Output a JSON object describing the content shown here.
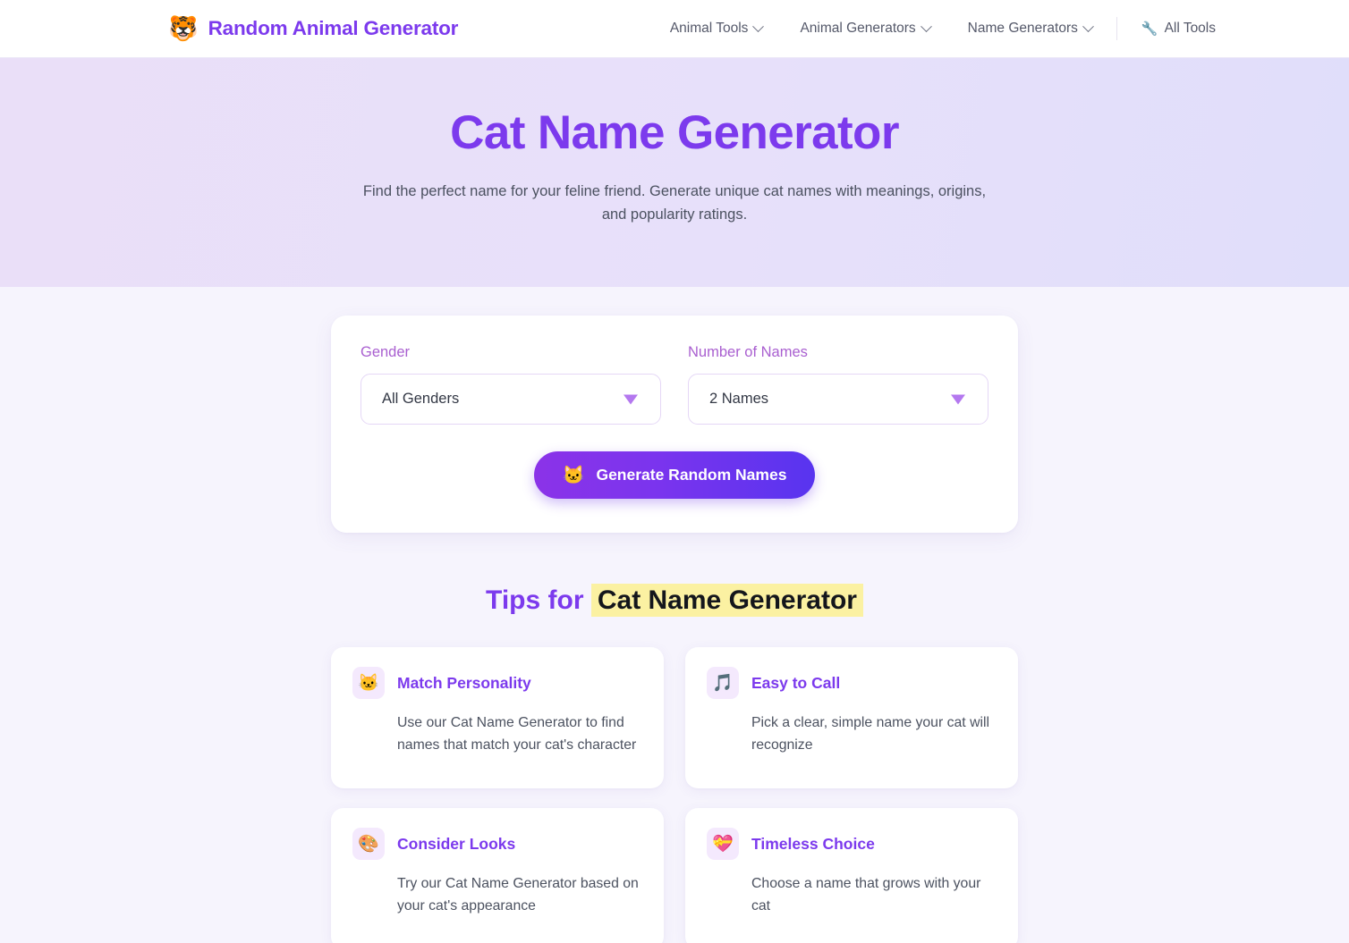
{
  "header": {
    "brand": {
      "logo_icon": "tiger-face-emoji",
      "logo_glyph": "🐯",
      "name": "Random Animal Generator"
    },
    "nav": [
      {
        "label": "Animal Tools",
        "has_caret": true
      },
      {
        "label": "Animal Generators",
        "has_caret": true
      },
      {
        "label": "Name Generators",
        "has_caret": true
      }
    ],
    "all_tools": {
      "label": "All Tools",
      "icon": "wrench-icon",
      "glyph": "🔧"
    }
  },
  "hero": {
    "title": "Cat Name Generator",
    "subtitle": "Find the perfect name for your feline friend. Generate unique cat names with meanings, origins, and popularity ratings."
  },
  "generator": {
    "gender": {
      "label": "Gender",
      "value": "All Genders"
    },
    "count": {
      "label": "Number of Names",
      "value": "2 Names"
    },
    "button": {
      "label": "Generate Random Names",
      "icon": "cat-face-emoji",
      "glyph": "🐱"
    }
  },
  "tips": {
    "heading_prefix": "Tips for ",
    "heading_topic": "Cat Name Generator",
    "cards": [
      {
        "icon": "cat-face-emoji",
        "glyph": "🐱",
        "title": "Match Personality",
        "text": "Use our Cat Name Generator to find names that match your cat's character"
      },
      {
        "icon": "musical-notes-icon",
        "glyph": "🎵",
        "title": "Easy to Call",
        "text": "Pick a clear, simple name your cat will recognize"
      },
      {
        "icon": "artist-palette-icon",
        "glyph": "🎨",
        "title": "Consider Looks",
        "text": "Try our Cat Name Generator based on your cat's appearance"
      },
      {
        "icon": "heart-with-ribbon-icon",
        "glyph": "💝",
        "title": "Timeless Choice",
        "text": "Choose a name that grows with your cat"
      }
    ]
  },
  "colors": {
    "brand_purple": "#7c3aed",
    "label_purple": "#a95fd0",
    "highlight_yellow": "#fbf1a2",
    "hero_bg_start": "#eadff8",
    "hero_bg_end": "#e0defa",
    "page_bg": "#f6f4fd"
  }
}
